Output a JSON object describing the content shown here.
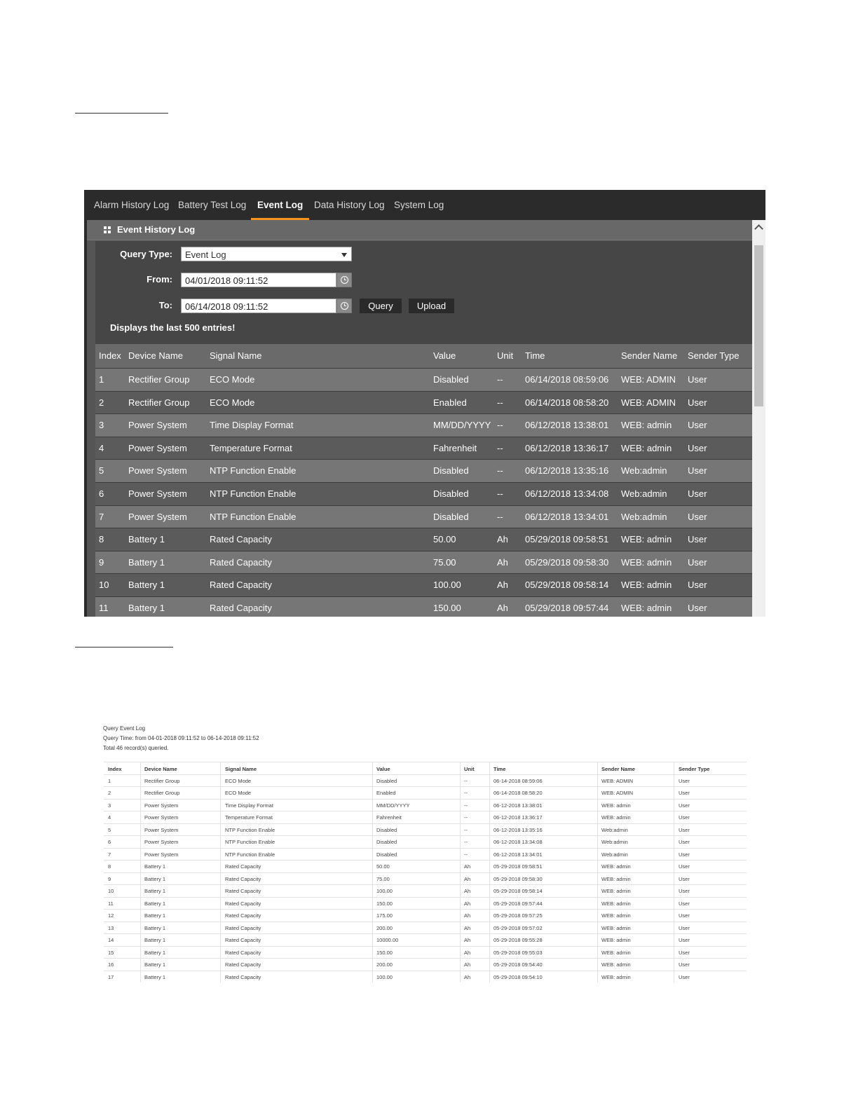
{
  "app": {
    "tabs": [
      "Alarm History Log",
      "Battery Test Log",
      "Event Log",
      "Data History Log",
      "System Log"
    ],
    "active_tab": "Event Log",
    "panel_title": "Event History Log",
    "form": {
      "query_type_label": "Query Type:",
      "query_type_value": "Event Log",
      "from_label": "From:",
      "from_value": "04/01/2018 09:11:52",
      "to_label": "To:",
      "to_value": "06/14/2018 09:11:52",
      "query_button": "Query",
      "upload_button": "Upload",
      "note": "Displays the last 500 entries!"
    },
    "table": {
      "headers": [
        "Index",
        "Device Name",
        "Signal Name",
        "Value",
        "Unit",
        "Time",
        "Sender Name",
        "Sender Type"
      ],
      "rows": [
        [
          "1",
          "Rectifier Group",
          "ECO Mode",
          "Disabled",
          "--",
          "06/14/2018 08:59:06",
          "WEB: ADMIN",
          "User"
        ],
        [
          "2",
          "Rectifier Group",
          "ECO Mode",
          "Enabled",
          "--",
          "06/14/2018 08:58:20",
          "WEB: ADMIN",
          "User"
        ],
        [
          "3",
          "Power System",
          "Time Display Format",
          "MM/DD/YYYY",
          "--",
          "06/12/2018 13:38:01",
          "WEB: admin",
          "User"
        ],
        [
          "4",
          "Power System",
          "Temperature Format",
          "Fahrenheit",
          "--",
          "06/12/2018 13:36:17",
          "WEB: admin",
          "User"
        ],
        [
          "5",
          "Power System",
          "NTP Function Enable",
          "Disabled",
          "--",
          "06/12/2018 13:35:16",
          "Web:admin",
          "User"
        ],
        [
          "6",
          "Power System",
          "NTP Function Enable",
          "Disabled",
          "--",
          "06/12/2018 13:34:08",
          "Web:admin",
          "User"
        ],
        [
          "7",
          "Power System",
          "NTP Function Enable",
          "Disabled",
          "--",
          "06/12/2018 13:34:01",
          "Web:admin",
          "User"
        ],
        [
          "8",
          "Battery 1",
          "Rated Capacity",
          "50.00",
          "Ah",
          "05/29/2018 09:58:51",
          "WEB: admin",
          "User"
        ],
        [
          "9",
          "Battery 1",
          "Rated Capacity",
          "75.00",
          "Ah",
          "05/29/2018 09:58:30",
          "WEB: admin",
          "User"
        ],
        [
          "10",
          "Battery 1",
          "Rated Capacity",
          "100.00",
          "Ah",
          "05/29/2018 09:58:14",
          "WEB: admin",
          "User"
        ],
        [
          "11",
          "Battery 1",
          "Rated Capacity",
          "150.00",
          "Ah",
          "05/29/2018 09:57:44",
          "WEB: admin",
          "User"
        ]
      ]
    }
  },
  "report": {
    "title": "Query Event Log",
    "query_time": "Query Time: from 04-01-2018 09:11:52 to 06-14-2018 09:11:52",
    "total": "Total 46 record(s) queried.",
    "headers": [
      "Index",
      "Device Name",
      "Signal Name",
      "Value",
      "Unit",
      "Time",
      "Sender Name",
      "Sender Type"
    ],
    "rows": [
      [
        "1",
        "Rectifier Group",
        "ECO Mode",
        "Disabled",
        "--",
        "06-14-2018 08:59:06",
        "WEB: ADMIN",
        "User"
      ],
      [
        "2",
        "Rectifier Group",
        "ECO Mode",
        "Enabled",
        "--",
        "06-14-2018 08:58:20",
        "WEB: ADMIN",
        "User"
      ],
      [
        "3",
        "Power System",
        "Time Display Format",
        "MM/DD/YYYY",
        "--",
        "06-12-2018 13:38:01",
        "WEB: admin",
        "User"
      ],
      [
        "4",
        "Power System",
        "Temperature Format",
        "Fahrenheit",
        "--",
        "06-12-2018 13:36:17",
        "WEB: admin",
        "User"
      ],
      [
        "5",
        "Power System",
        "NTP Function Enable",
        "Disabled",
        "--",
        "06-12-2018 13:35:16",
        "Web:admin",
        "User"
      ],
      [
        "6",
        "Power System",
        "NTP Function Enable",
        "Disabled",
        "--",
        "06-12-2018 13:34:08",
        "Web:admin",
        "User"
      ],
      [
        "7",
        "Power System",
        "NTP Function Enable",
        "Disabled",
        "--",
        "06-12-2018 13:34:01",
        "Web:admin",
        "User"
      ],
      [
        "8",
        "Battery 1",
        "Rated Capacity",
        "50.00",
        "Ah",
        "05-29-2018 09:58:51",
        "WEB: admin",
        "User"
      ],
      [
        "9",
        "Battery 1",
        "Rated Capacity",
        "75.00",
        "Ah",
        "05-29-2018 09:58:30",
        "WEB: admin",
        "User"
      ],
      [
        "10",
        "Battery 1",
        "Rated Capacity",
        "100.00",
        "Ah",
        "05-29-2018 09:58:14",
        "WEB: admin",
        "User"
      ],
      [
        "11",
        "Battery 1",
        "Rated Capacity",
        "150.00",
        "Ah",
        "05-29-2018 09:57:44",
        "WEB: admin",
        "User"
      ],
      [
        "12",
        "Battery 1",
        "Rated Capacity",
        "175.00",
        "Ah",
        "05-29-2018 09:57:25",
        "WEB: admin",
        "User"
      ],
      [
        "13",
        "Battery 1",
        "Rated Capacity",
        "200.00",
        "Ah",
        "05-29-2018 09:57:02",
        "WEB: admin",
        "User"
      ],
      [
        "14",
        "Battery 1",
        "Rated Capacity",
        "10000.00",
        "Ah",
        "05-29-2018 09:55:28",
        "WEB: admin",
        "User"
      ],
      [
        "15",
        "Battery 1",
        "Rated Capacity",
        "150.00",
        "Ah",
        "05-29-2018 09:55:03",
        "WEB: admin",
        "User"
      ],
      [
        "16",
        "Battery 1",
        "Rated Capacity",
        "200.00",
        "Ah",
        "05-29-2018 09:54:40",
        "WEB: admin",
        "User"
      ],
      [
        "17",
        "Battery 1",
        "Rated Capacity",
        "100.00",
        "Ah",
        "05-29-2018 09:54:10",
        "WEB: admin",
        "User"
      ]
    ]
  },
  "colors": {
    "accent": "#f7941d",
    "panel": "#555555",
    "row_light": "#767676",
    "row_dark": "#5b5b5b"
  },
  "icons": [
    "grid-icon",
    "clock-icon",
    "dropdown-caret-icon",
    "scroll-up-icon"
  ]
}
